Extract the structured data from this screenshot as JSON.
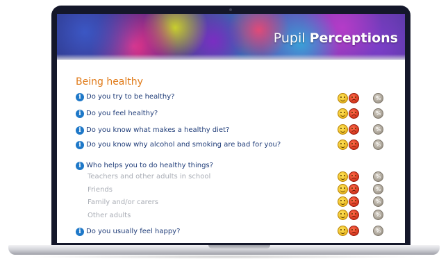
{
  "banner": {
    "title_light": "Pupil ",
    "title_bold": "Perceptions"
  },
  "section": {
    "title": "Being healthy"
  },
  "info_glyph": "i",
  "questions": [
    {
      "label": "Do you try to be healthy?"
    },
    {
      "label": "Do you feel healthy?"
    },
    {
      "label": "Do you know what makes a healthy diet?"
    },
    {
      "label": "Do you know why alcohol and smoking are bad for you?"
    },
    {
      "label": "Who helps you to do healthy things?"
    },
    {
      "label": "Do you usually feel happy?"
    }
  ],
  "sub_items": [
    {
      "label": "Teachers and other adults in school"
    },
    {
      "label": "Friends"
    },
    {
      "label": "Family and/or carers"
    },
    {
      "label": "Other adults"
    }
  ],
  "icons": {
    "happy": "smiley-happy-icon",
    "sad": "smiley-sad-icon",
    "na": "not-applicable-icon",
    "info": "info-icon"
  },
  "colors": {
    "section_title": "#e07b1a",
    "question_text": "#1f3c78",
    "sub_text": "#a9adb5",
    "info_icon": "#1e78c8",
    "bezel": "#14172a"
  }
}
